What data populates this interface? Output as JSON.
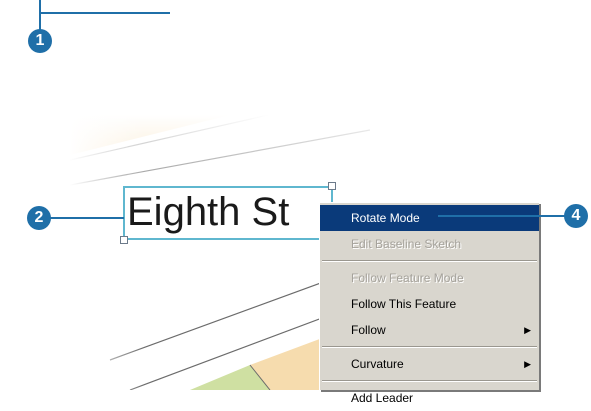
{
  "callouts": {
    "c1": "1",
    "c2": "2",
    "c4": "4"
  },
  "map_label": {
    "text": "Eighth St"
  },
  "context_menu": {
    "items": [
      {
        "label": "Rotate Mode"
      },
      {
        "label": "Edit Baseline Sketch"
      },
      {
        "label": "Follow Feature Mode"
      },
      {
        "label": "Follow This Feature"
      },
      {
        "label": "Follow"
      },
      {
        "label": "Curvature"
      },
      {
        "label": "Add Leader"
      }
    ]
  },
  "colors": {
    "callout": "#1f6fa8",
    "selection": "#0a3a7a",
    "parcel_tan": "#f6dcae",
    "parcel_green": "#cfe0a2"
  }
}
